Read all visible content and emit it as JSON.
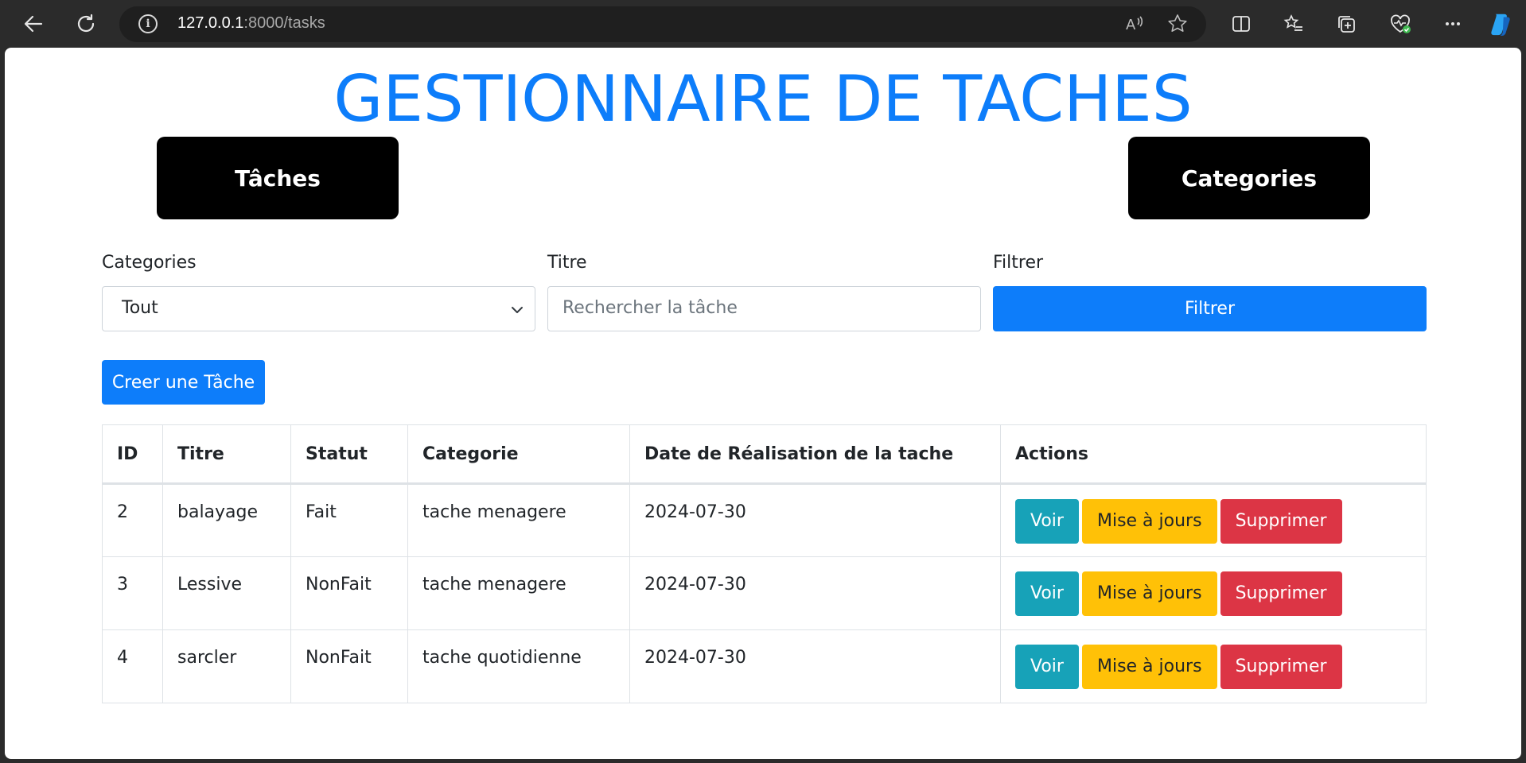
{
  "browser": {
    "url_host": "127.0.0.1",
    "url_rest": ":8000/tasks"
  },
  "header": {
    "title": "GESTIONNAIRE DE TACHES"
  },
  "nav": {
    "tasks_label": "Tâches",
    "categories_label": "Categories"
  },
  "filters": {
    "category_label": "Categories",
    "category_value": "Tout",
    "title_label": "Titre",
    "title_placeholder": "Rechercher la tâche",
    "filter_label": "Filtrer",
    "filter_button": "Filtrer"
  },
  "create_button": "Creer une Tâche",
  "table": {
    "headers": [
      "ID",
      "Titre",
      "Statut",
      "Categorie",
      "Date de Réalisation de la tache",
      "Actions"
    ],
    "rows": [
      {
        "id": "2",
        "titre": "balayage",
        "statut": "Fait",
        "categorie": "tache menagere",
        "date": "2024-07-30"
      },
      {
        "id": "3",
        "titre": "Lessive",
        "statut": "NonFait",
        "categorie": "tache menagere",
        "date": "2024-07-30"
      },
      {
        "id": "4",
        "titre": "sarcler",
        "statut": "NonFait",
        "categorie": "tache quotidienne",
        "date": "2024-07-30"
      }
    ],
    "actions": {
      "view": "Voir",
      "update": "Mise à jours",
      "delete": "Supprimer"
    }
  },
  "colors": {
    "primary": "#0d7dfa",
    "info": "#17a2b8",
    "warning": "#ffc107",
    "danger": "#dc3545"
  }
}
